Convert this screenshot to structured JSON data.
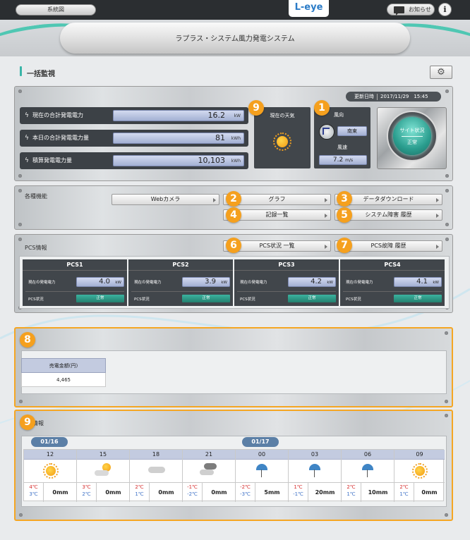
{
  "topbar": {
    "system_button": "系統図",
    "logo": "L-eye",
    "notice_button": "お知らせ",
    "info_button": "i"
  },
  "header": {
    "title": "ラプラス・システム風力発電システム"
  },
  "page": {
    "title": "一括監視",
    "settings_icon": "gear-icon"
  },
  "status": {
    "updated_label": "更新日時",
    "updated_value": "2017/11/29　15:45",
    "rows": [
      {
        "label": "現在の合計発電電力",
        "value": "16.2",
        "unit": "kW"
      },
      {
        "label": "本日の合計発電電力量",
        "value": "81",
        "unit": "kWh"
      },
      {
        "label": "積算発電電力量",
        "value": "10,103",
        "unit": "kWh"
      }
    ],
    "weather": {
      "label": "現在の天気",
      "icon": "sunny-icon"
    },
    "wind": {
      "dir_label": "風向",
      "dir_value": "南東",
      "speed_label": "風速",
      "speed_value": "7.2",
      "speed_unit": "m/s"
    },
    "site": {
      "label": "サイト状況",
      "value": "正常"
    }
  },
  "badges": [
    "9",
    "1",
    "2",
    "3",
    "4",
    "5",
    "6",
    "7",
    "8",
    "9"
  ],
  "functions": {
    "label": "各種機能",
    "webcam": "Webカメラ",
    "graph": "グラフ",
    "download": "データダウンロード",
    "records": "記録一覧",
    "faults": "システム障害 履歴"
  },
  "pcs": {
    "label": "PCS情報",
    "status_list_button": "PCS状況 一覧",
    "fault_history_button": "PCS故障 履歴",
    "power_label": "現在の発電電力",
    "status_label": "PCS状況",
    "unit": "kW",
    "units": [
      {
        "name": "PCS1",
        "power": "4.0",
        "status": "正常"
      },
      {
        "name": "PCS2",
        "power": "3.9",
        "status": "正常"
      },
      {
        "name": "PCS3",
        "power": "4.2",
        "status": "正常"
      },
      {
        "name": "PCS4",
        "power": "4.1",
        "status": "正常"
      }
    ]
  },
  "sales": {
    "header": "売電金額(円)",
    "value": "4,465"
  },
  "forecast": {
    "label": "情報",
    "dates": [
      "01/16",
      "01/17"
    ],
    "slots": [
      {
        "time": "12",
        "icon": "sunny-icon",
        "hi": "4℃",
        "lo": "3℃",
        "rain": "0mm"
      },
      {
        "time": "15",
        "icon": "sun-cloud-icon",
        "hi": "3℃",
        "lo": "2℃",
        "rain": "0mm"
      },
      {
        "time": "18",
        "icon": "cloud-icon",
        "hi": "2℃",
        "lo": "1℃",
        "rain": "0mm"
      },
      {
        "time": "21",
        "icon": "dark-cloud-icon",
        "hi": "-1℃",
        "lo": "-2℃",
        "rain": "0mm"
      },
      {
        "time": "00",
        "icon": "umbrella-icon",
        "hi": "-2℃",
        "lo": "-3℃",
        "rain": "5mm"
      },
      {
        "time": "03",
        "icon": "umbrella-icon",
        "hi": "1℃",
        "lo": "-1℃",
        "rain": "20mm"
      },
      {
        "time": "06",
        "icon": "umbrella-icon",
        "hi": "2℃",
        "lo": "1℃",
        "rain": "10mm"
      },
      {
        "time": "09",
        "icon": "sunny-icon",
        "hi": "2℃",
        "lo": "1℃",
        "rain": "0mm"
      }
    ]
  },
  "colors": {
    "accent": "#f5a01e",
    "teal": "#2a9d8e",
    "dark_panel": "#41464b",
    "highlight_border": "#f5a623"
  }
}
